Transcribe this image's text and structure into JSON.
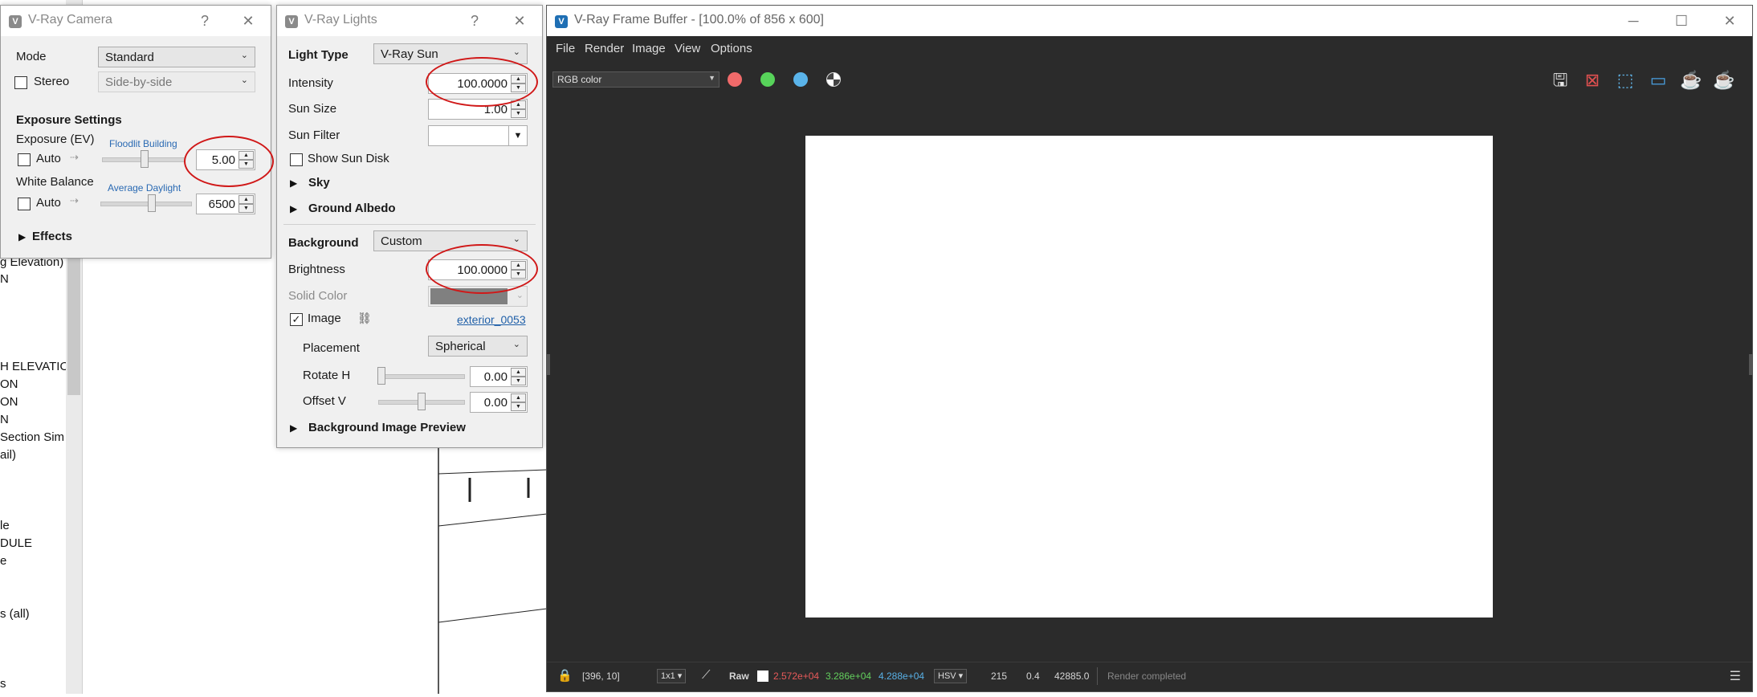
{
  "background_app": {
    "list_items": [
      "g Elevation)",
      "N",
      "H ELEVATIO",
      "ON",
      "ON",
      "N",
      "Section Sim",
      "ail)",
      "le",
      "DULE",
      "e",
      "s (all)",
      "s"
    ]
  },
  "vray_camera": {
    "title": "V-Ray Camera",
    "help": "?",
    "close": "✕",
    "mode_label": "Mode",
    "mode_value": "Standard",
    "stereo_label": "Stereo",
    "stereo_value": "Side-by-side",
    "exposure_settings": "Exposure Settings",
    "exposure_label": "Exposure (EV)",
    "exposure_preset": "Floodlit Building",
    "exposure_auto": "Auto",
    "exposure_value": "5.00",
    "white_balance_label": "White Balance",
    "wb_preset": "Average Daylight",
    "wb_auto": "Auto",
    "wb_value": "6500",
    "effects": "Effects"
  },
  "vray_lights": {
    "title": "V-Ray Lights",
    "help": "?",
    "close": "✕",
    "light_type_label": "Light Type",
    "light_type_value": "V-Ray Sun",
    "intensity_label": "Intensity",
    "intensity_value": "100.0000",
    "sun_size_label": "Sun Size",
    "sun_size_value": "1.00",
    "sun_filter_label": "Sun Filter",
    "show_sun_disk": "Show Sun Disk",
    "sky": "Sky",
    "ground_albedo": "Ground Albedo",
    "background_label": "Background",
    "background_value": "Custom",
    "brightness_label": "Brightness",
    "brightness_value": "100.0000",
    "solid_color_label": "Solid Color",
    "image_label": "Image",
    "image_link": "exterior_0053",
    "placement_label": "Placement",
    "placement_value": "Spherical",
    "rotate_h_label": "Rotate H",
    "rotate_h_value": "0.00",
    "offset_v_label": "Offset V",
    "offset_v_value": "0.00",
    "bg_preview": "Background Image Preview"
  },
  "frame_buffer": {
    "title": "V-Ray Frame Buffer - [100.0% of 856 x 600]",
    "menu": [
      "File",
      "Render",
      "Image",
      "View",
      "Options"
    ],
    "channel": "RGB color",
    "colors": {
      "red": "#f06a6a",
      "green": "#57d35a",
      "blue": "#5ab4ea"
    },
    "status": {
      "coords": "[396, 10]",
      "ratio": "1x1",
      "mode": "Raw",
      "r": "2.572e+04",
      "g": "3.286e+04",
      "b": "4.288e+04",
      "color_space": "HSV",
      "h": "215",
      "s": "0.4",
      "v": "42885.0",
      "message": "Render completed"
    },
    "window_controls": [
      "─",
      "☐",
      "✕"
    ]
  }
}
